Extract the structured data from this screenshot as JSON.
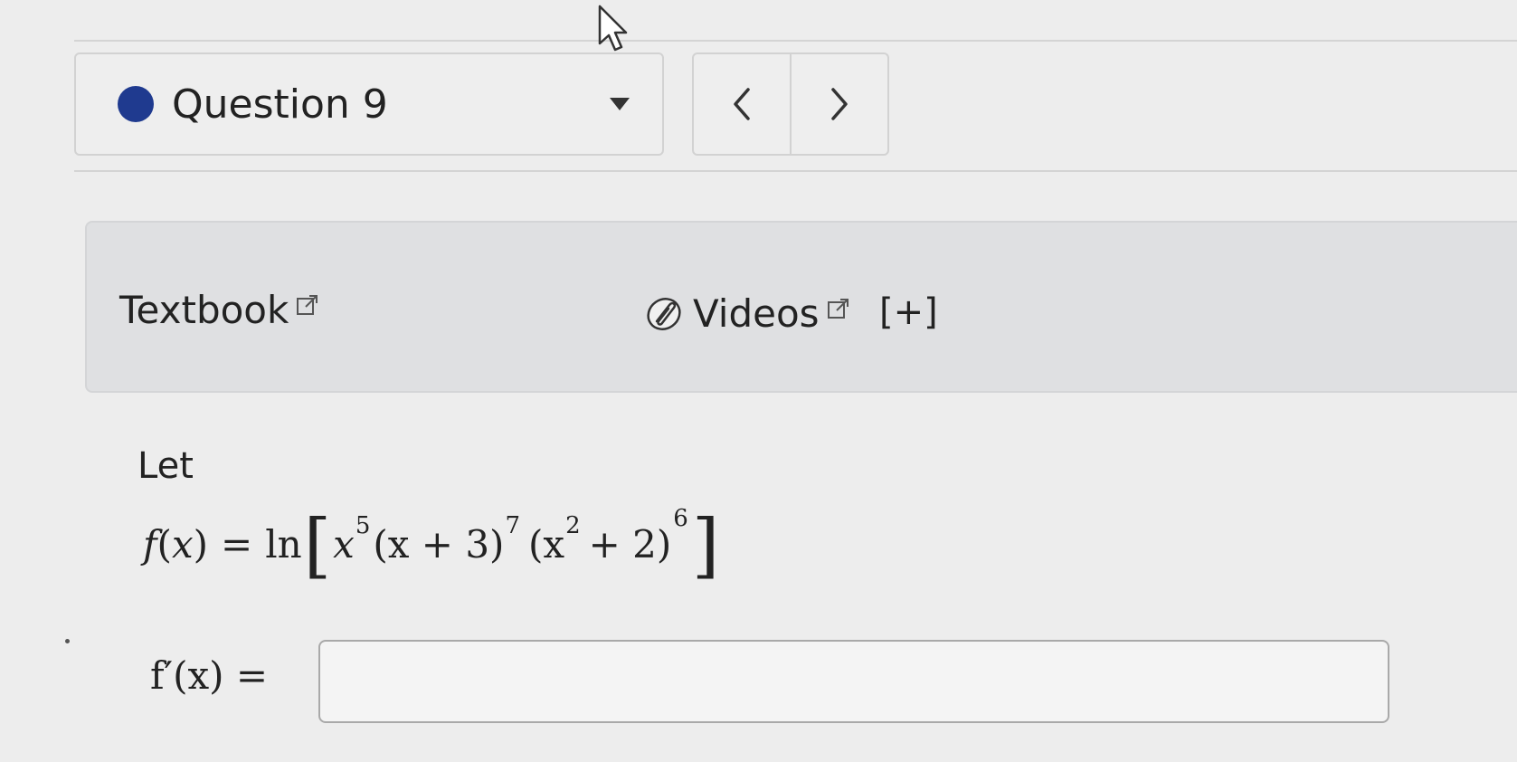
{
  "question": {
    "label": "Question 9",
    "status_color": "#1f3a8f"
  },
  "nav": {
    "prev_label": "<",
    "next_label": ">"
  },
  "resources": {
    "textbook_label": "Textbook",
    "videos_label": "Videos",
    "expand_label": "[+]",
    "icons": [
      "external-link-icon",
      "paperclip-icon"
    ]
  },
  "problem": {
    "intro": "Let",
    "function_name": "f",
    "variable": "x",
    "equals": "=",
    "ln": "ln",
    "term1_base": "x",
    "term1_exp": "5",
    "term2": "(x + 3)",
    "term2_exp": "7",
    "term3_open": "(x",
    "term3_inner_exp": "2",
    "term3_close": "+ 2)",
    "term3_exp": "6",
    "derivative_label": "f′(x) ="
  },
  "answer": {
    "value": "",
    "placeholder": ""
  },
  "colors": {
    "background": "#ededed",
    "panel": "#dfe0e2",
    "accent": "#1f3a8f"
  }
}
